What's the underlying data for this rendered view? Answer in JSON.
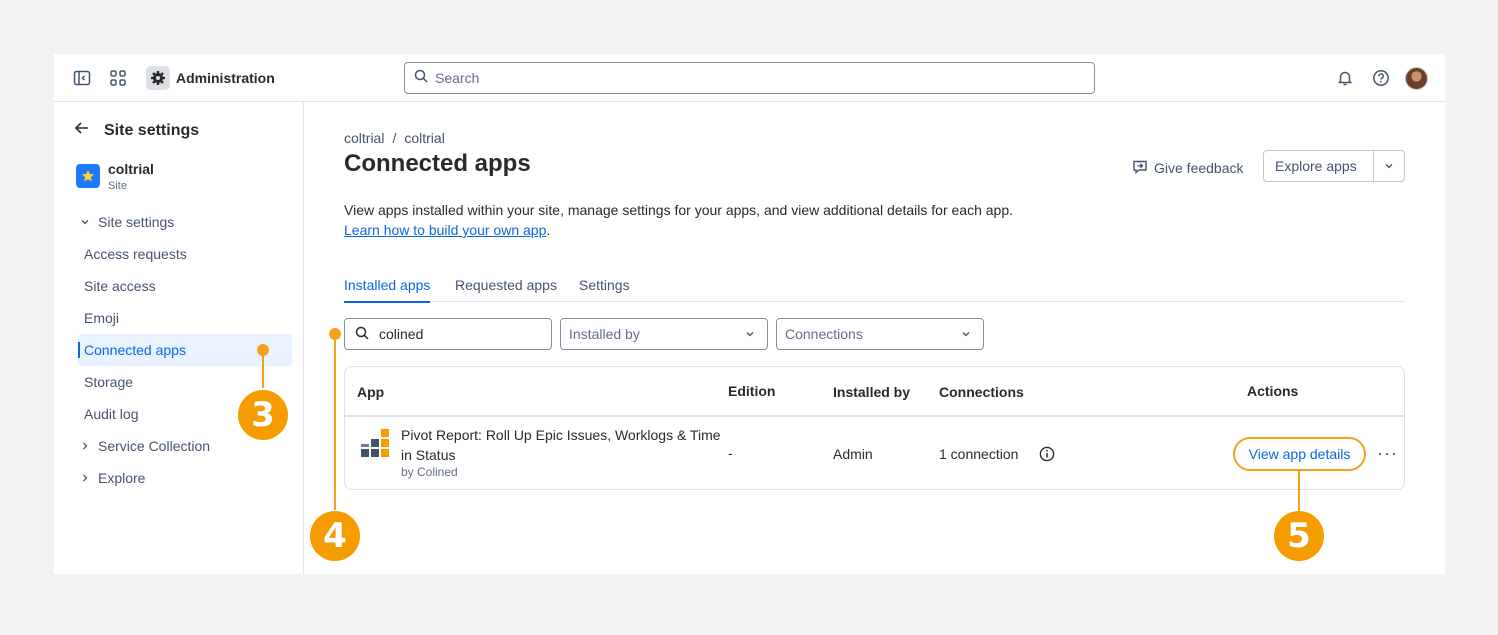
{
  "topbar": {
    "title": "Administration",
    "search_placeholder": "Search"
  },
  "sidebar": {
    "back_label": "Site settings",
    "site_name": "coltrial",
    "site_type": "Site",
    "section_label": "Site settings",
    "items": [
      {
        "label": "Access requests"
      },
      {
        "label": "Site access"
      },
      {
        "label": "Emoji"
      },
      {
        "label": "Connected apps"
      },
      {
        "label": "Storage"
      },
      {
        "label": "Audit log"
      }
    ],
    "groups": [
      {
        "label": "Service Collection"
      },
      {
        "label": "Explore"
      }
    ]
  },
  "main": {
    "breadcrumb": [
      "coltrial",
      "coltrial"
    ],
    "breadcrumb_sep": "/",
    "title": "Connected apps",
    "feedback_label": "Give feedback",
    "explore_label": "Explore apps",
    "description": "View apps installed within your site, manage settings for your apps, and view additional details for each app.",
    "learn_link": "Learn how to build your own app",
    "learn_suffix": ".",
    "tabs": [
      {
        "label": "Installed apps"
      },
      {
        "label": "Requested apps"
      },
      {
        "label": "Settings"
      }
    ],
    "filters": {
      "search_value": "colined",
      "installed_by": "Installed by",
      "connections": "Connections"
    },
    "table": {
      "headers": [
        "App",
        "Edition",
        "Installed by",
        "Connections",
        "Actions"
      ],
      "rows": [
        {
          "app_name": "Pivot Report: Roll Up Epic Issues, Worklogs & Time in Status",
          "app_vendor": "by Colined",
          "edition": "-",
          "installed_by": "Admin",
          "connections": "1 connection",
          "action_label": "View app details",
          "more_label": "···"
        }
      ]
    }
  },
  "callouts": [
    "3",
    "4",
    "5"
  ],
  "colors": {
    "accent": "#0c66e4",
    "callout": "#f59c00",
    "site_icon": "#1d7afc"
  }
}
